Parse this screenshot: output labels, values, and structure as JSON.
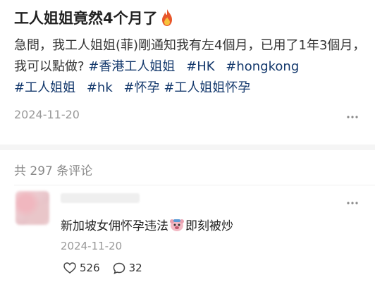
{
  "post": {
    "title": "工人姐姐竟然4个月了",
    "title_icon": "fire-emoji-icon",
    "body": "急問，我工人姐姐(菲)剛通知我有左4個月，已用了1年3個月，我可以點做?",
    "hashtags": [
      "#香港工人姐姐",
      "#HK",
      "#hongkong",
      "#工人姐姐",
      "#hk",
      "#怀孕",
      "#工人姐姐怀孕"
    ],
    "date": "2024-11-20",
    "more_icon": "more-horizontal-icon"
  },
  "comments": {
    "count_label": "共 297 条评论"
  },
  "comment": {
    "avatar": "blurred-avatar",
    "text_before": "新加坡女佣怀孕违法",
    "emoji": "face-emoji-icon",
    "text_after": "即刻被炒",
    "date": "2024-11-20",
    "likes": "526",
    "replies": "32"
  },
  "colors": {
    "hashtag": "#13386c",
    "muted": "#999999",
    "text": "#333333"
  }
}
